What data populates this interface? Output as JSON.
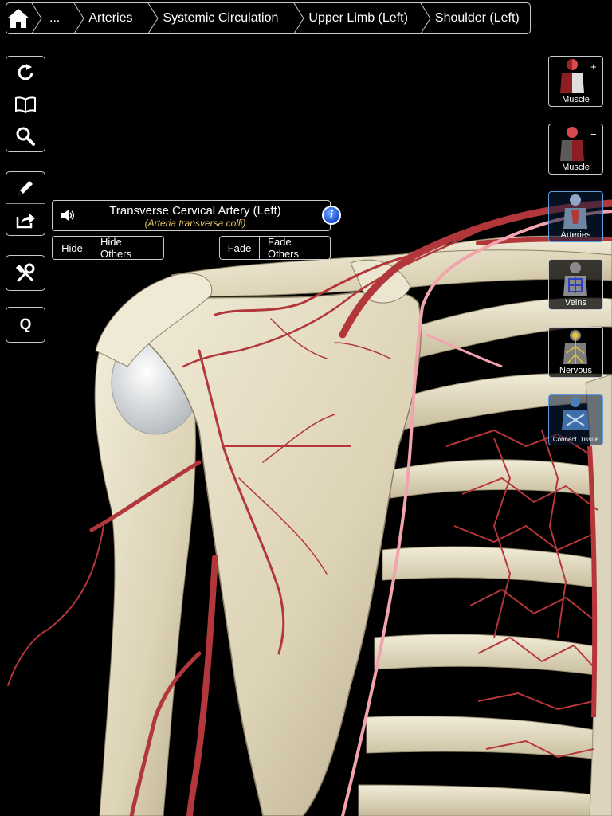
{
  "breadcrumb": {
    "items": [
      "...",
      "Arteries",
      "Systemic Circulation",
      "Upper Limb (Left)",
      "Shoulder (Left)"
    ]
  },
  "toolbar": {
    "quiz_label": "Q"
  },
  "selection": {
    "title": "Transverse Cervical Artery (Left)",
    "latin": "(Arteria transversa colli)"
  },
  "actions": {
    "hide": "Hide",
    "hide_others": "Hide Others",
    "fade": "Fade",
    "fade_others": "Fade Others"
  },
  "layers": [
    {
      "label": "Muscle",
      "mode": "+"
    },
    {
      "label": "Muscle",
      "mode": "−"
    },
    {
      "label": "Arteries"
    },
    {
      "label": "Veins"
    },
    {
      "label": "Nervous"
    },
    {
      "label": "Connect. Tissue"
    }
  ],
  "colors": {
    "artery": "#b2373a",
    "artery_highlight": "#f2a3ad",
    "bone": "#e4dcc3",
    "info_accent": "#2f64e0",
    "latin_text": "#e7c66a"
  }
}
